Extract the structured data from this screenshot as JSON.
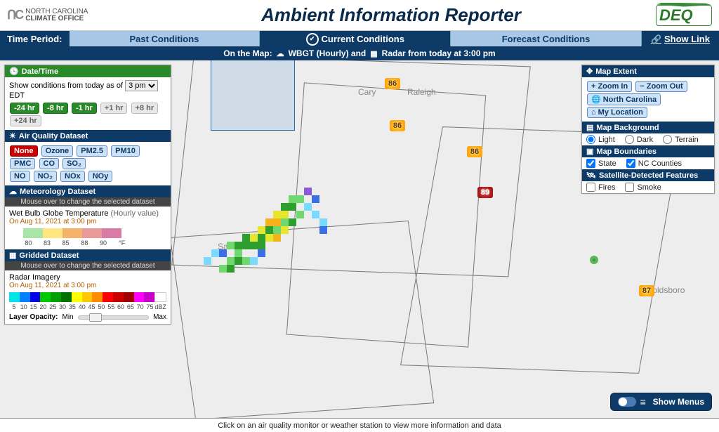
{
  "header": {
    "left_logo_top": "NORTH CAROLINA",
    "left_logo_bottom": "CLIMATE OFFICE",
    "title": "Ambient Information Reporter",
    "right_logo": "DEQ"
  },
  "tabs": {
    "label": "Time Period:",
    "past": "Past Conditions",
    "current": "Current Conditions",
    "forecast": "Forecast Conditions",
    "show_link": "Show Link"
  },
  "subbar": {
    "on_map": "On the Map:",
    "wbgt": "WBGT (Hourly) and",
    "radar": "Radar from today at 3:00 pm"
  },
  "datetime_panel": {
    "header": "Date/Time",
    "show_conditions": "Show conditions from today as of",
    "selected_time": "3 pm",
    "tz": "EDT",
    "btn_m24": "-24 hr",
    "btn_m8": "-8 hr",
    "btn_m1": "-1 hr",
    "btn_p1": "+1 hr",
    "btn_p8": "+8 hr",
    "btn_p24": "+24 hr"
  },
  "aq_panel": {
    "header": "Air Quality Dataset",
    "none": "None",
    "ozone": "Ozone",
    "pm25": "PM2.5",
    "pm10": "PM10",
    "pmc": "PMC",
    "co": "CO",
    "so2": "SO₂",
    "no": "NO",
    "no2": "NO₂",
    "nox": "NOx",
    "noy": "NOy"
  },
  "meteo_panel": {
    "header": "Meteorology Dataset",
    "hint": "Mouse over to change the selected dataset",
    "title": "Wet Bulb Globe Temperature",
    "title_suffix": "(Hourly value)",
    "subtitle": "On Aug 11, 2021 at 3:00 pm",
    "ticks": [
      "80",
      "83",
      "85",
      "88",
      "90",
      "°F"
    ]
  },
  "grid_panel": {
    "header": "Gridded Dataset",
    "hint": "Mouse over to change the selected dataset",
    "title": "Radar Imagery",
    "subtitle": "On Aug 11, 2021 at 3:00 pm",
    "ticks": [
      "5",
      "10",
      "15",
      "20",
      "25",
      "30",
      "35",
      "40",
      "45",
      "50",
      "55",
      "60",
      "65",
      "70",
      "75",
      "dBZ"
    ],
    "opacity_label": "Layer Opacity:",
    "min": "Min",
    "max": "Max"
  },
  "map_extent": {
    "header": "Map Extent",
    "zoom_in": "Zoom In",
    "zoom_out": "Zoom Out",
    "nc": "North Carolina",
    "myloc": "My Location"
  },
  "map_bg": {
    "header": "Map Background",
    "light": "Light",
    "dark": "Dark",
    "terrain": "Terrain"
  },
  "map_bound": {
    "header": "Map Boundaries",
    "state": "State",
    "counties": "NC Counties"
  },
  "sat": {
    "header": "Satellite-Detected Features",
    "fires": "Fires",
    "smoke": "Smoke"
  },
  "cities": {
    "cary": "Cary",
    "raleigh": "Raleigh",
    "sanford": "Sanford",
    "goldsboro": "Goldsboro"
  },
  "wbgt_values": {
    "a": "86",
    "b": "86",
    "c": "86",
    "d": "89",
    "e": "87"
  },
  "show_menus": "Show Menus",
  "footer": "Click on an air quality monitor or weather station to view more information and data"
}
